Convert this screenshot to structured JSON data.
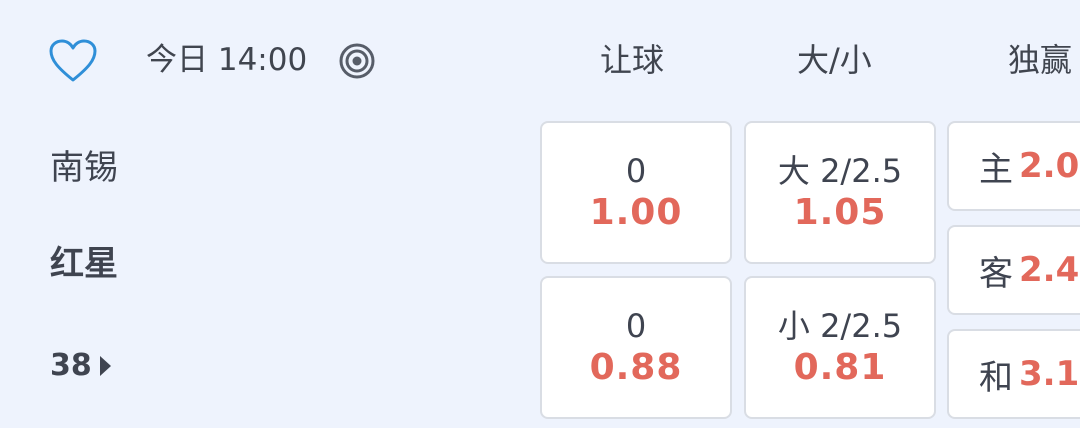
{
  "match": {
    "time": "今日 14:00",
    "home_team": "南锡",
    "away_team": "红星",
    "more_count": "38"
  },
  "columns": {
    "handicap": "让球",
    "over_under": "大/小",
    "win": "独赢"
  },
  "handicap": {
    "home": {
      "line": "0",
      "odds": "1.00"
    },
    "away": {
      "line": "0",
      "odds": "0.88"
    }
  },
  "over_under": {
    "over": {
      "line": "大 2/2.5",
      "odds": "1.05"
    },
    "under": {
      "line": "小 2/2.5",
      "odds": "0.81"
    }
  },
  "win": {
    "home": {
      "label": "主",
      "odds": "2.0"
    },
    "away": {
      "label": "客",
      "odds": "2.4"
    },
    "draw": {
      "label": "和",
      "odds": "3.1"
    }
  },
  "colors": {
    "accent": "#2f8fd8",
    "odds": "#e2685b",
    "background": "#eef3fd"
  },
  "icons": {
    "favorite": "heart-icon",
    "live": "target-icon",
    "more": "triangle-right-icon"
  }
}
